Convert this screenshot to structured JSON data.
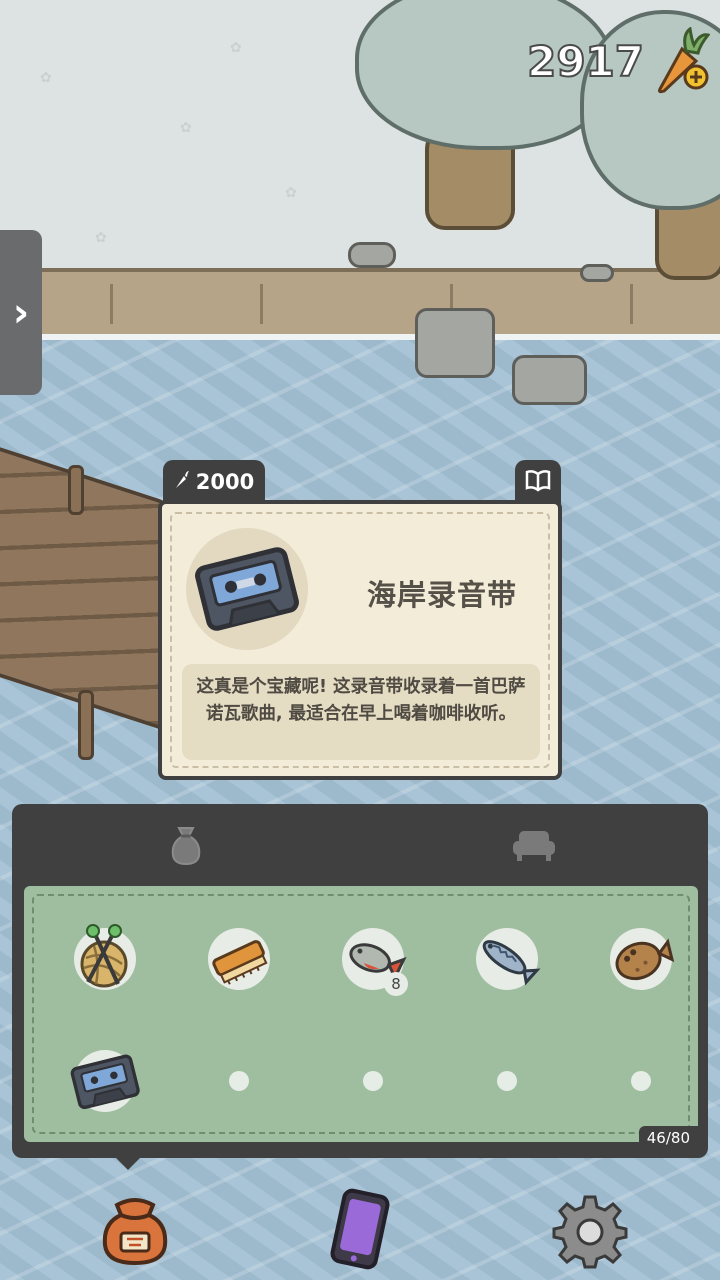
{
  "hud": {
    "carrot_count": "2917",
    "carrot_icon": "carrot-plus-icon",
    "side_tab_glyph": "›"
  },
  "item_detail": {
    "price": "2000",
    "price_icon": "carrot-icon",
    "guide_icon": "book-icon",
    "name": "海岸录音带",
    "icon": "cassette-tape-icon",
    "description": "这真是个宝藏呢! 这录音带收录着一首巴萨诺瓦歌曲, 最适合在早上喝着咖啡收听。"
  },
  "inventory": {
    "tabs": [
      {
        "icon": "bag-icon",
        "active": true
      },
      {
        "icon": "furniture-icon",
        "active": false
      }
    ],
    "slots": [
      {
        "item": "yarn-ball-icon",
        "count": ""
      },
      {
        "item": "scrub-brush-icon",
        "count": ""
      },
      {
        "item": "red-fish-icon",
        "count": "8"
      },
      {
        "item": "mackerel-icon",
        "count": ""
      },
      {
        "item": "flatfish-icon",
        "count": ""
      },
      {
        "item": "cassette-tape-icon",
        "count": ""
      },
      {
        "item": "",
        "count": ""
      },
      {
        "item": "",
        "count": ""
      },
      {
        "item": "",
        "count": ""
      },
      {
        "item": "",
        "count": ""
      }
    ],
    "capacity": "46/80"
  },
  "bottom_nav": [
    {
      "icon": "backpack-sack-icon"
    },
    {
      "icon": "phone-icon"
    },
    {
      "icon": "settings-gear-icon"
    }
  ],
  "colors": {
    "panel_dark": "#404040",
    "card_bg": "#f3ecd9",
    "inventory_green": "#9fbe9f",
    "water": "#a9c4d6",
    "snow": "#dde3e3"
  }
}
